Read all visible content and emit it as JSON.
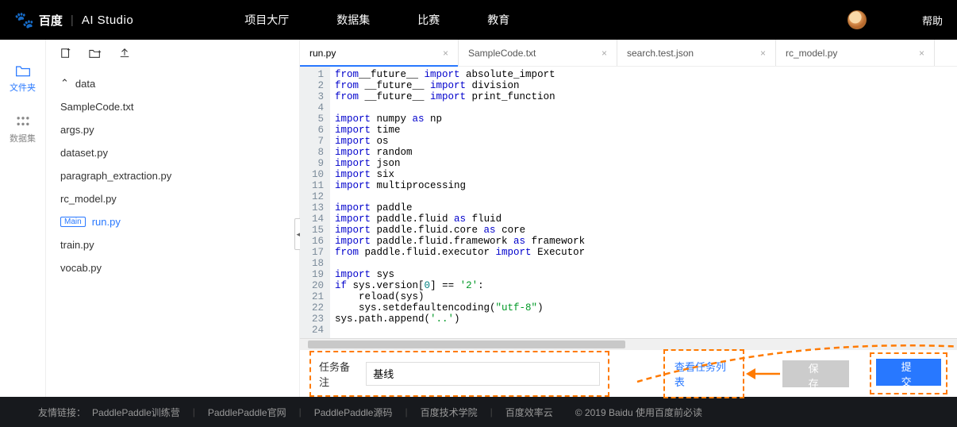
{
  "brand": {
    "baidu": "百度",
    "studio": "AI Studio"
  },
  "nav": {
    "hall": "项目大厅",
    "dataset": "数据集",
    "contest": "比赛",
    "edu": "教育",
    "help": "帮助"
  },
  "side": {
    "files": "文件夹",
    "datasets": "数据集"
  },
  "tree": {
    "folder": "data",
    "files": [
      "SampleCode.txt",
      "args.py",
      "dataset.py",
      "paragraph_extraction.py",
      "rc_model.py",
      "run.py",
      "train.py",
      "vocab.py"
    ],
    "main_badge": "Main"
  },
  "tabs": [
    {
      "label": "run.py"
    },
    {
      "label": "SampleCode.txt"
    },
    {
      "label": "search.test.json"
    },
    {
      "label": "rc_model.py"
    }
  ],
  "gutter": "  1\n  2\n  3\n  4\n  5\n  6\n  7\n  8\n  9\n 10\n 11\n 12\n 13\n 14\n 15\n 16\n 17\n 18\n 19\n 20\n 21\n 22\n 23\n 24",
  "code_lines": [
    [
      [
        "kw",
        "from"
      ],
      [
        "",
        ""
      ],
      [
        "",
        "__future__ "
      ],
      [
        "kw",
        "import"
      ],
      [
        "",
        " absolute_import"
      ]
    ],
    [
      [
        "kw",
        "from"
      ],
      [
        "",
        " __future__ "
      ],
      [
        "kw",
        "import"
      ],
      [
        "",
        " division"
      ]
    ],
    [
      [
        "kw",
        "from"
      ],
      [
        "",
        " __future__ "
      ],
      [
        "kw",
        "import"
      ],
      [
        "",
        " print_function"
      ]
    ],
    [
      [
        "",
        ""
      ]
    ],
    [
      [
        "kw",
        "import"
      ],
      [
        "",
        " numpy "
      ],
      [
        "kw",
        "as"
      ],
      [
        "",
        " np"
      ]
    ],
    [
      [
        "kw",
        "import"
      ],
      [
        "",
        " time"
      ]
    ],
    [
      [
        "kw",
        "import"
      ],
      [
        "",
        " os"
      ]
    ],
    [
      [
        "kw",
        "import"
      ],
      [
        "",
        " random"
      ]
    ],
    [
      [
        "kw",
        "import"
      ],
      [
        "",
        " json"
      ]
    ],
    [
      [
        "kw",
        "import"
      ],
      [
        "",
        " six"
      ]
    ],
    [
      [
        "kw",
        "import"
      ],
      [
        "",
        " multiprocessing"
      ]
    ],
    [
      [
        "",
        ""
      ]
    ],
    [
      [
        "kw",
        "import"
      ],
      [
        "",
        " paddle"
      ]
    ],
    [
      [
        "kw",
        "import"
      ],
      [
        "",
        " paddle.fluid "
      ],
      [
        "kw",
        "as"
      ],
      [
        "",
        " fluid"
      ]
    ],
    [
      [
        "kw",
        "import"
      ],
      [
        "",
        " paddle.fluid.core "
      ],
      [
        "kw",
        "as"
      ],
      [
        "",
        " core"
      ]
    ],
    [
      [
        "kw",
        "import"
      ],
      [
        "",
        " paddle.fluid.framework "
      ],
      [
        "kw",
        "as"
      ],
      [
        "",
        " framework"
      ]
    ],
    [
      [
        "kw",
        "from"
      ],
      [
        "",
        " paddle.fluid.executor "
      ],
      [
        "kw",
        "import"
      ],
      [
        "",
        " Executor"
      ]
    ],
    [
      [
        "",
        ""
      ]
    ],
    [
      [
        "kw",
        "import"
      ],
      [
        "",
        " sys"
      ]
    ],
    [
      [
        "kw",
        "if"
      ],
      [
        "",
        " sys.version["
      ],
      [
        "num",
        "0"
      ],
      [
        "",
        "] == "
      ],
      [
        "str",
        "'2'"
      ],
      [
        "",
        ":"
      ]
    ],
    [
      [
        "",
        "    reload(sys)"
      ]
    ],
    [
      [
        "",
        "    sys.setdefaultencoding("
      ],
      [
        "str",
        "\"utf-8\""
      ],
      [
        "",
        ")"
      ]
    ],
    [
      [
        "",
        "sys.path.append("
      ],
      [
        "str",
        "'..'"
      ],
      [
        "",
        ")"
      ]
    ],
    [
      [
        "",
        ""
      ]
    ]
  ],
  "bottom": {
    "remark_label": "任务备注",
    "remark_value": "基线",
    "view_list": "查看任务列表",
    "save": "保存",
    "submit": "提交"
  },
  "footer": {
    "label": "友情链接：",
    "links": [
      "PaddlePaddle训练营",
      "PaddlePaddle官网",
      "PaddlePaddle源码",
      "百度技术学院",
      "百度效率云"
    ],
    "copy": "© 2019 Baidu 使用百度前必读"
  }
}
